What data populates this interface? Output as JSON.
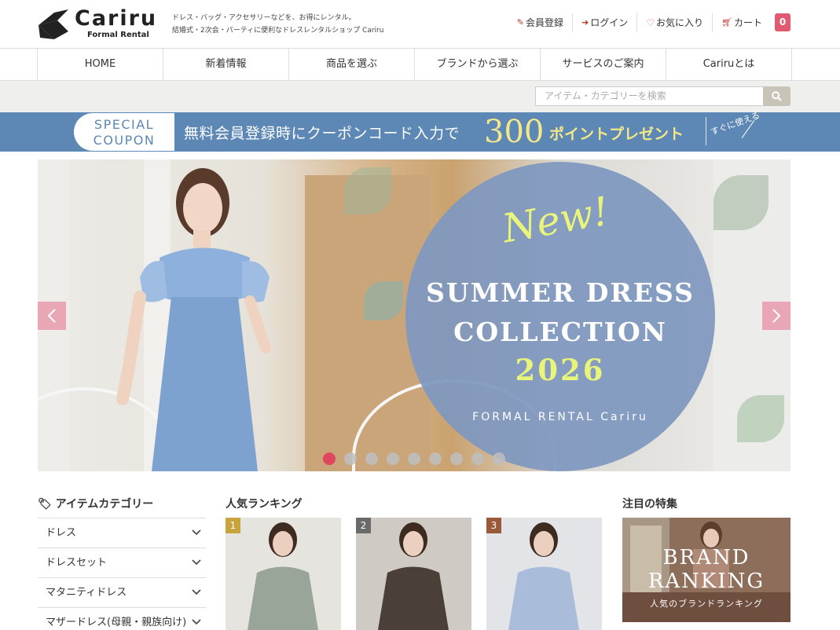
{
  "header": {
    "logo_name": "Cariru",
    "logo_sub": "Formal Rental",
    "tagline_1": "ドレス・バッグ・アクセサリーなどを、お得にレンタル。",
    "tagline_2": "結婚式・2次会・パーティに便利なドレスレンタルショップ Cariru",
    "links": {
      "register": "会員登録",
      "login": "ログイン",
      "favorites": "お気に入り",
      "cart": "カート"
    },
    "cart_count": "0"
  },
  "main_nav": [
    "HOME",
    "新着情報",
    "商品を選ぶ",
    "ブランドから選ぶ",
    "サービスのご案内",
    "Cariruとは"
  ],
  "search": {
    "placeholder": "アイテム・カテゴリーを検索"
  },
  "coupon": {
    "badge_line1": "SPECIAL",
    "badge_line2": "COUPON",
    "text": "無料会員登録時にクーポンコード入力で",
    "number": "300",
    "present": "ポイントプレゼント",
    "note": "すぐに使える"
  },
  "hero": {
    "new": "New!",
    "title_line1": "SUMMER DRESS",
    "title_line2": "COLLECTION",
    "year": "2026",
    "brand": "FORMAL RENTAL Cariru",
    "slide_count": 9,
    "active_slide": 1
  },
  "categories": {
    "title": "アイテムカテゴリー",
    "items": [
      "ドレス",
      "ドレスセット",
      "マタニティドレス",
      "マザードレス(母親・親族向け)"
    ]
  },
  "ranking": {
    "title": "人気ランキング",
    "items": [
      {
        "rank": "1",
        "color": "#c9a43c"
      },
      {
        "rank": "2",
        "color": "#6a6a6a"
      },
      {
        "rank": "3",
        "color": "#9a5a3a"
      }
    ]
  },
  "features": {
    "title": "注目の特集",
    "banner_line1": "BRAND",
    "banner_line2": "RANKING",
    "banner_sub": "人気のブランドランキング"
  },
  "colors": {
    "accent": "#e05a72",
    "coupon_bg": "#5d87b5",
    "highlight": "#f4e78a"
  }
}
